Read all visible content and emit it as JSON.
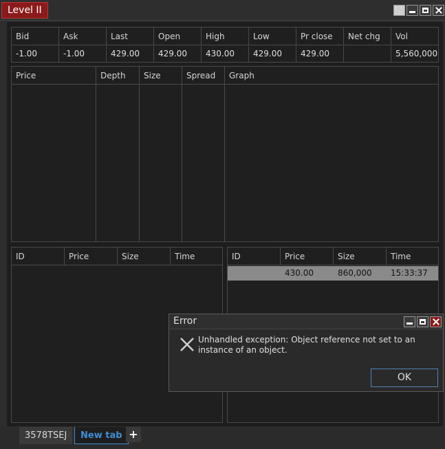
{
  "window": {
    "title": "Level II"
  },
  "quote": {
    "headers": [
      "Bid",
      "Ask",
      "Last",
      "Open",
      "High",
      "Low",
      "Pr close",
      "Net chg",
      "Vol"
    ],
    "values": [
      "-1.00",
      "-1.00",
      "429.00",
      "429.00",
      "430.00",
      "429.00",
      "429.00",
      "",
      "5,560,000"
    ]
  },
  "book": {
    "headers": [
      "Price",
      "Depth",
      "Size",
      "Spread",
      "Graph"
    ]
  },
  "bids": {
    "headers": [
      "ID",
      "Price",
      "Size",
      "Time"
    ],
    "rows": []
  },
  "asks": {
    "headers": [
      "ID",
      "Price",
      "Size",
      "Time"
    ],
    "rows": [
      {
        "id": "",
        "price": "430.00",
        "size": "860,000",
        "time": "15:33:37"
      }
    ]
  },
  "dialog": {
    "title": "Error",
    "message": "Unhandled exception: Object reference not set to an instance of an object.",
    "ok_label": "OK"
  },
  "tabs": [
    {
      "label": "3578TSEJ"
    },
    {
      "label": "New tab"
    }
  ],
  "tab_add": "+",
  "colors": {
    "title_bg": "#8b1a1a",
    "active_tab": "#3f8fd6",
    "selected_row": "#8a8a8a"
  }
}
